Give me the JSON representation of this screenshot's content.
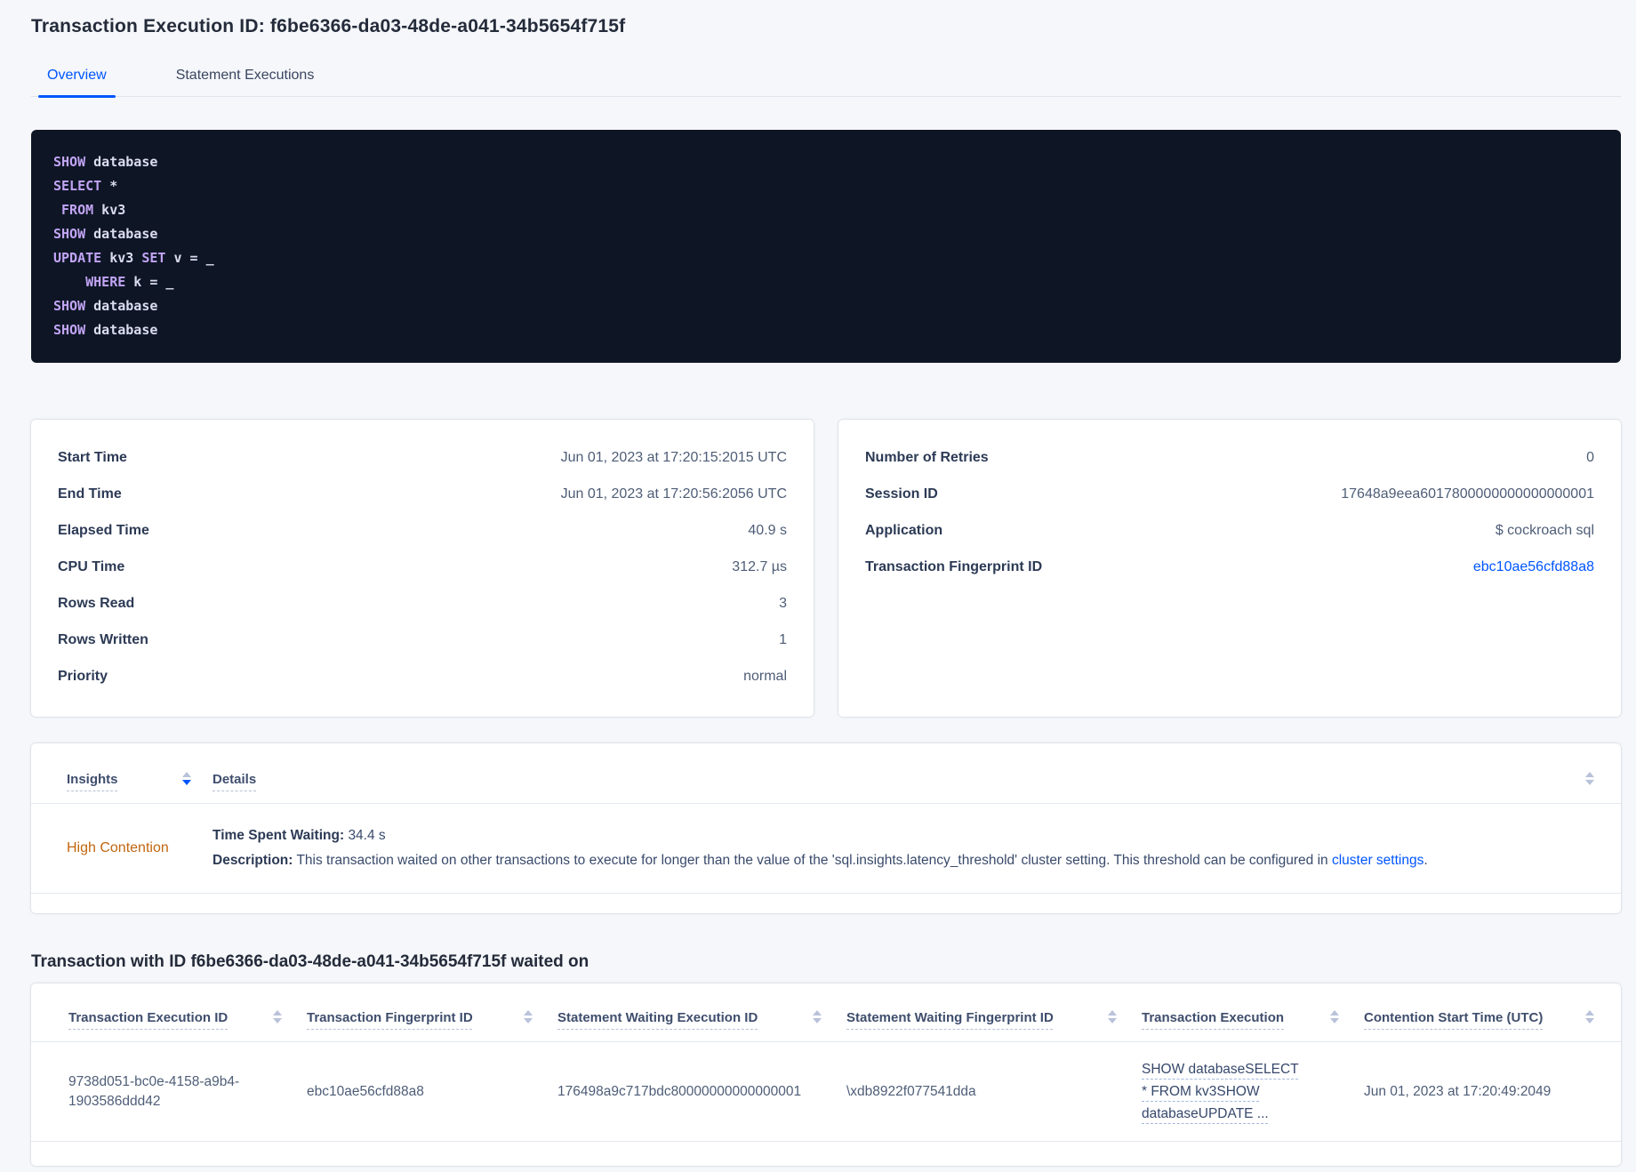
{
  "colors": {
    "accent_blue": "#0055ff",
    "warning_orange": "#c2660f",
    "code_background": "#0e1626",
    "code_keyword": "#c2a4f4"
  },
  "page": {
    "title": "Transaction Execution ID: f6be6366-da03-48de-a041-34b5654f715f",
    "tabs": [
      {
        "label": "Overview",
        "active": true
      },
      {
        "label": "Statement Executions",
        "active": false
      }
    ]
  },
  "sql_box": {
    "lines": [
      [
        {
          "t": "SHOW",
          "k": 1
        },
        {
          "t": " database",
          "k": 0
        }
      ],
      [
        {
          "t": "SELECT",
          "k": 1
        },
        {
          "t": " *",
          "k": 0
        }
      ],
      [
        {
          "t": " ",
          "k": 0
        },
        {
          "t": "FROM",
          "k": 1
        },
        {
          "t": " kv3",
          "k": 0
        }
      ],
      [
        {
          "t": "SHOW",
          "k": 1
        },
        {
          "t": " database",
          "k": 0
        }
      ],
      [
        {
          "t": "UPDATE",
          "k": 1
        },
        {
          "t": " kv3 ",
          "k": 0
        },
        {
          "t": "SET",
          "k": 1
        },
        {
          "t": " v = _",
          "k": 0
        }
      ],
      [
        {
          "t": "    ",
          "k": 0
        },
        {
          "t": "WHERE",
          "k": 1
        },
        {
          "t": " k = _",
          "k": 0
        }
      ],
      [
        {
          "t": "SHOW",
          "k": 1
        },
        {
          "t": " database",
          "k": 0
        }
      ],
      [
        {
          "t": "SHOW",
          "k": 1
        },
        {
          "t": " database",
          "k": 0
        }
      ]
    ]
  },
  "summary_left": {
    "rows": [
      {
        "label": "Start Time",
        "value": "Jun 01, 2023 at 17:20:15:2015 UTC"
      },
      {
        "label": "End Time",
        "value": "Jun 01, 2023 at 17:20:56:2056 UTC"
      },
      {
        "label": "Elapsed Time",
        "value": "40.9 s"
      },
      {
        "label": "CPU Time",
        "value": "312.7 µs"
      },
      {
        "label": "Rows Read",
        "value": "3"
      },
      {
        "label": "Rows Written",
        "value": "1"
      },
      {
        "label": "Priority",
        "value": "normal"
      }
    ]
  },
  "summary_right": {
    "rows": [
      {
        "label": "Number of Retries",
        "value": "0"
      },
      {
        "label": "Session ID",
        "value": "17648a9eea6017800000000000000001"
      },
      {
        "label": "Application",
        "value": "$ cockroach sql"
      },
      {
        "label": "Transaction Fingerprint ID",
        "value": "ebc10ae56cfd88a8",
        "link": true
      }
    ]
  },
  "insights": {
    "columns": [
      "Insights",
      "Details"
    ],
    "row": {
      "insight": "High Contention",
      "waiting_label": "Time Spent Waiting:",
      "waiting_value": "34.4 s",
      "description_label": "Description:",
      "description_text": "This transaction waited on other transactions to execute for longer than the value of the 'sql.insights.latency_threshold' cluster setting. This threshold can be configured in ",
      "description_link": "cluster settings",
      "description_suffix": "."
    }
  },
  "waited_on": {
    "heading": "Transaction with ID f6be6366-da03-48de-a041-34b5654f715f waited on",
    "columns": [
      "Transaction Execution ID",
      "Transaction Fingerprint ID",
      "Statement Waiting Execution ID",
      "Statement Waiting Fingerprint ID",
      "Transaction Execution",
      "Contention Start Time (UTC)"
    ],
    "row": {
      "transaction_execution_id": "9738d051-bc0e-4158-a9b4-1903586ddd42",
      "transaction_fingerprint_id": "ebc10ae56cfd88a8",
      "statement_waiting_execution_id": "176498a9c717bdc80000000000000001",
      "statement_waiting_fingerprint_id": "\\xdb8922f077541dda",
      "transaction_execution": "SHOW databaseSELECT * FROM kv3SHOW databaseUPDATE ...",
      "contention_start_time": "Jun 01, 2023 at 17:20:49:2049"
    }
  }
}
